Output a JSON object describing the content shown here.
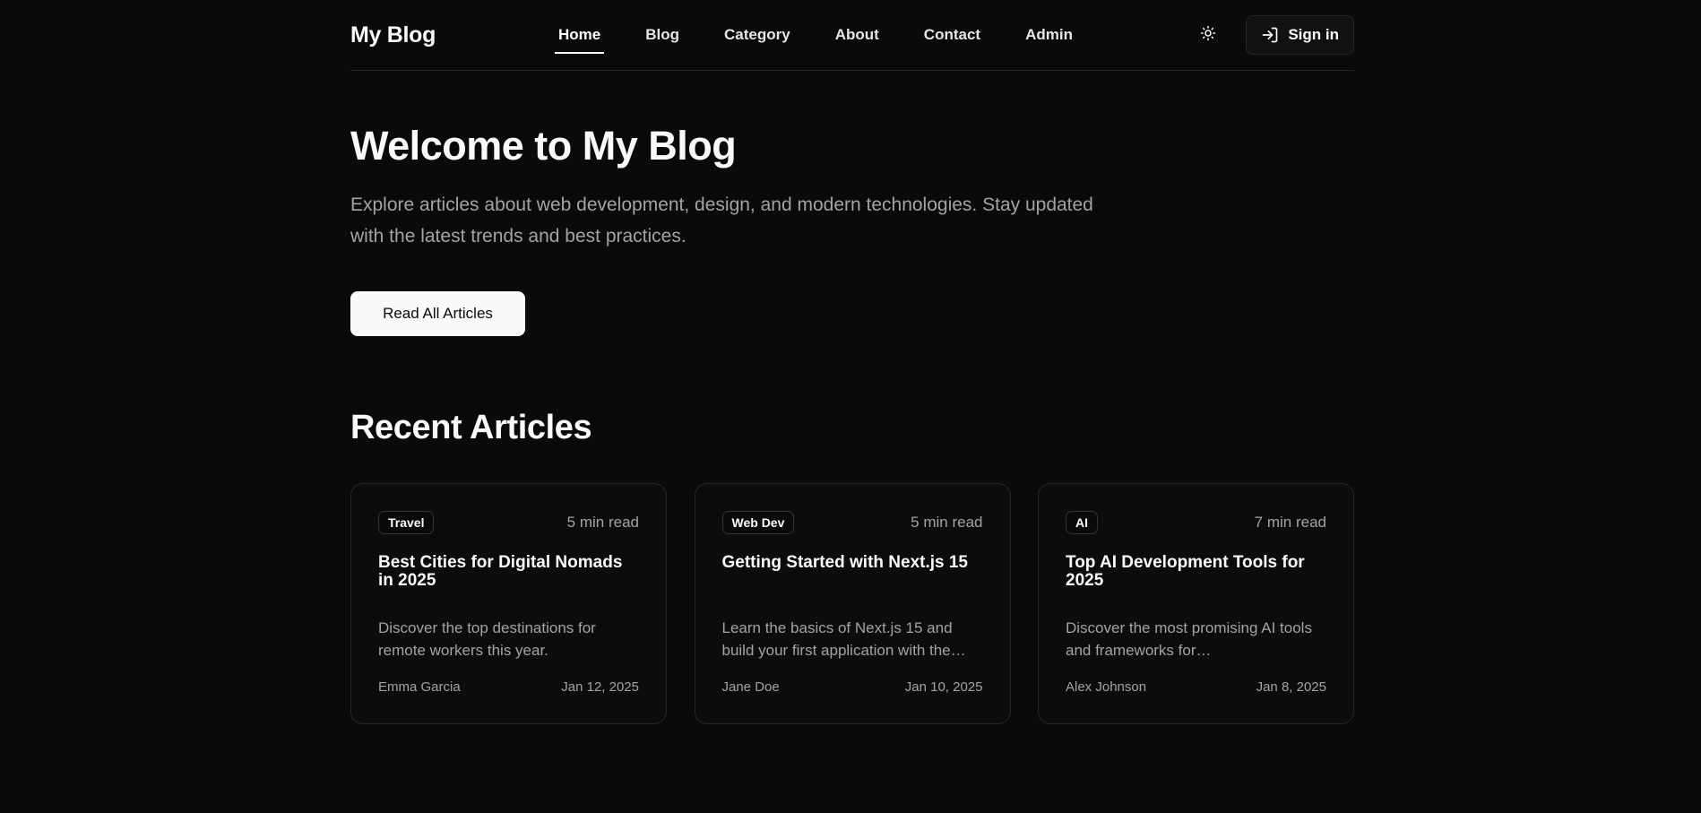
{
  "header": {
    "logo": "My Blog",
    "nav": [
      {
        "label": "Home",
        "active": true
      },
      {
        "label": "Blog",
        "active": false
      },
      {
        "label": "Category",
        "active": false
      },
      {
        "label": "About",
        "active": false
      },
      {
        "label": "Contact",
        "active": false
      },
      {
        "label": "Admin",
        "active": false
      }
    ],
    "theme_icon": "sun-icon",
    "signin_icon": "log-in-icon",
    "signin_label": "Sign in"
  },
  "hero": {
    "title": "Welcome to My Blog",
    "description": "Explore articles about web development, design, and modern technologies. Stay updated with the latest trends and best practices.",
    "cta_label": "Read All Articles"
  },
  "recent": {
    "title": "Recent Articles",
    "articles": [
      {
        "category": "Travel",
        "read_time": "5 min read",
        "title": "Best Cities for Digital Nomads in 2025",
        "excerpt": "Discover the top destinations for remote workers this year.",
        "author": "Emma Garcia",
        "date": "Jan 12, 2025"
      },
      {
        "category": "Web Dev",
        "read_time": "5 min read",
        "title": "Getting Started with Next.js 15",
        "excerpt": "Learn the basics of Next.js 15 and build your first application with the…",
        "author": "Jane Doe",
        "date": "Jan 10, 2025"
      },
      {
        "category": "AI",
        "read_time": "7 min read",
        "title": "Top AI Development Tools for 2025",
        "excerpt": "Discover the most promising AI tools and frameworks for…",
        "author": "Alex Johnson",
        "date": "Jan 8, 2025"
      }
    ]
  },
  "colors": {
    "background": "#0a0a0a",
    "foreground": "#fafafa",
    "muted": "#a3a3a3",
    "border": "#262626"
  }
}
